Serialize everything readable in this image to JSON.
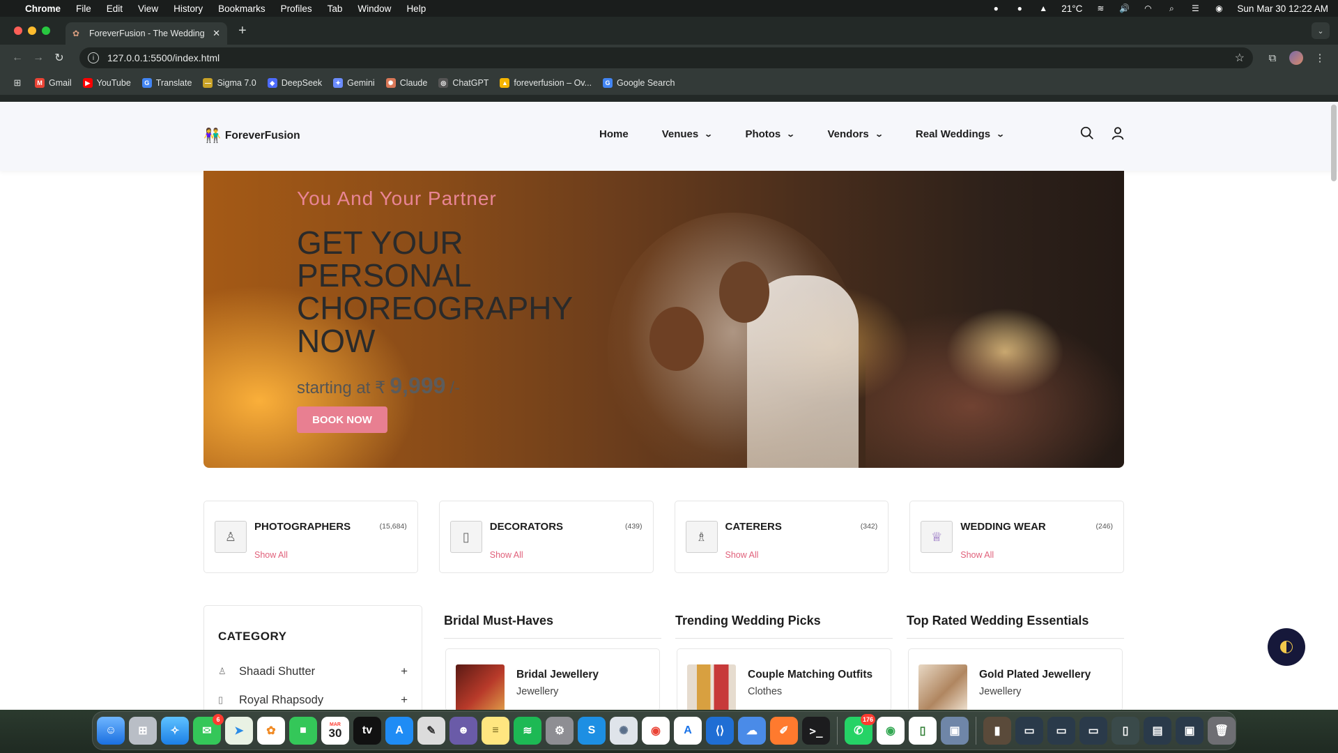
{
  "menubar": {
    "app": "Chrome",
    "items": [
      "File",
      "Edit",
      "View",
      "History",
      "Bookmarks",
      "Profiles",
      "Tab",
      "Window",
      "Help"
    ],
    "temperature": "21°C",
    "datetime": "Sun Mar 30  12:22 AM"
  },
  "browser": {
    "tab_title": "ForeverFusion - The Wedding",
    "url": "127.0.0.1:5500/index.html",
    "bookmarks": [
      {
        "label": "Gmail",
        "color": "#ea4335",
        "glyph": "M"
      },
      {
        "label": "YouTube",
        "color": "#ff0000",
        "glyph": "▶"
      },
      {
        "label": "Translate",
        "color": "#4285f4",
        "glyph": "G"
      },
      {
        "label": "Sigma 7.0",
        "color": "#c9a227",
        "glyph": "—"
      },
      {
        "label": "DeepSeek",
        "color": "#4d6bfe",
        "glyph": "◆"
      },
      {
        "label": "Gemini",
        "color": "#6b8cff",
        "glyph": "✦"
      },
      {
        "label": "Claude",
        "color": "#d97757",
        "glyph": "✺"
      },
      {
        "label": "ChatGPT",
        "color": "#555555",
        "glyph": "◎"
      },
      {
        "label": "foreverfusion – Ov...",
        "color": "#f4b400",
        "glyph": "▲"
      },
      {
        "label": "Google Search",
        "color": "#4285f4",
        "glyph": "G"
      }
    ]
  },
  "site": {
    "logo": "ForeverFusion",
    "nav": [
      {
        "label": "Home",
        "dropdown": false
      },
      {
        "label": "Venues",
        "dropdown": true
      },
      {
        "label": "Photos",
        "dropdown": true
      },
      {
        "label": "Vendors",
        "dropdown": true
      },
      {
        "label": "Real Weddings",
        "dropdown": true
      }
    ],
    "hero": {
      "subtitle": "You And Your Partner",
      "headline": "GET YOUR PERSONAL CHOREOGRAPHY NOW",
      "starting_text": "starting at ₹",
      "price": "9,999",
      "price_suffix": "/-",
      "cta": "BOOK NOW"
    },
    "categories": [
      {
        "name": "PHOTOGRAPHERS",
        "count": "(15,684)",
        "link": "Show All",
        "icon": "photographer-icon"
      },
      {
        "name": "DECORATORS",
        "count": "(439)",
        "link": "Show All",
        "icon": "decorator-icon"
      },
      {
        "name": "CATERERS",
        "count": "(342)",
        "link": "Show All",
        "icon": "caterer-icon"
      },
      {
        "name": "WEDDING WEAR",
        "count": "(246)",
        "link": "Show All",
        "icon": "wedding-wear-icon"
      }
    ],
    "sidebar": {
      "title": "CATEGORY",
      "items": [
        {
          "label": "Shaadi Shutter"
        },
        {
          "label": "Royal Rhapsody"
        }
      ]
    },
    "columns": [
      {
        "heading": "Bridal Must-Haves",
        "product": "Bridal Jewellery",
        "category": "Jewellery"
      },
      {
        "heading": "Trending Wedding Picks",
        "product": "Couple Matching Outfits",
        "category": "Clothes"
      },
      {
        "heading": "Top Rated Wedding Essentials",
        "product": "Gold Plated Jewellery",
        "category": "Jewellery"
      }
    ]
  },
  "dock": {
    "calendar_month": "MAR",
    "calendar_day": "30",
    "messages_badge": "6",
    "whatsapp_badge": "176"
  }
}
